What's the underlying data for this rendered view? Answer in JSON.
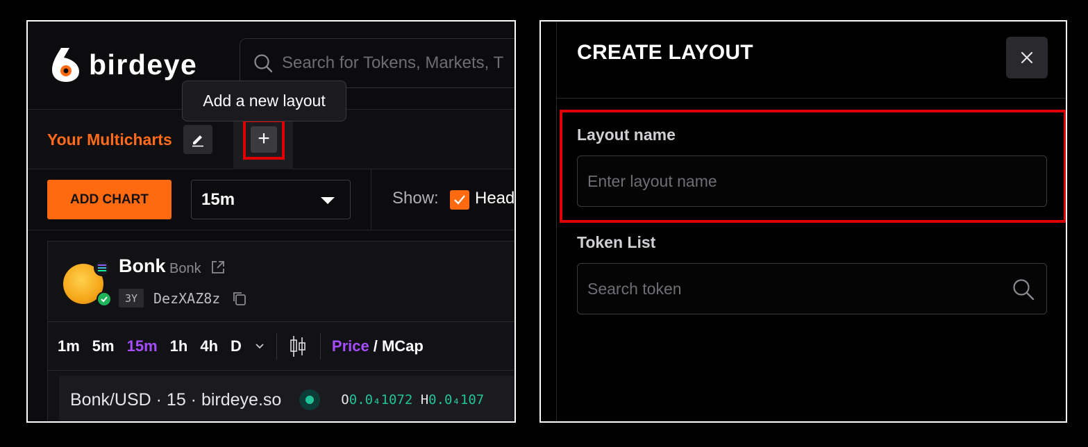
{
  "left": {
    "logo_text": "birdeye",
    "search_placeholder": "Search for Tokens, Markets, T",
    "tooltip": "Add a new layout",
    "multicharts_title": "Your Multicharts",
    "add_tab_glyph": "+",
    "add_chart_label": "ADD CHART",
    "interval_value": "15m",
    "show_label": "Show:",
    "header_checkbox_label": "Head",
    "token": {
      "name": "Bonk",
      "symbol": "Bonk",
      "age": "3Y",
      "address": "DezXAZ8z"
    },
    "timeframes": [
      "1m",
      "5m",
      "15m",
      "1h",
      "4h",
      "D"
    ],
    "active_timeframe": "15m",
    "price_toggle": "Price",
    "mcap_toggle": "/ MCap",
    "pair_label": "Bonk/USD · 15 · birdeye.so",
    "ohlc": {
      "o_label": "O",
      "o_value": "0.0₄1072",
      "h_label": "H",
      "h_value": "0.0₄107"
    },
    "colors": {
      "accent_orange": "#ff6a10",
      "active_purple": "#a64dff",
      "positive_green": "#22c39a"
    },
    "icons": [
      "birdeye-logo-icon",
      "search-icon",
      "edit-icon",
      "plus-icon",
      "chevron-down-icon",
      "external-link-icon",
      "copy-icon",
      "candlestick-icon",
      "solana-icon",
      "verified-icon"
    ]
  },
  "right": {
    "modal_title": "CREATE LAYOUT",
    "layout_name_label": "Layout name",
    "layout_name_placeholder": "Enter layout name",
    "token_list_label": "Token List",
    "token_search_placeholder": "Search token",
    "icons": [
      "close-icon",
      "search-icon"
    ],
    "highlight_color": "#e00000"
  }
}
